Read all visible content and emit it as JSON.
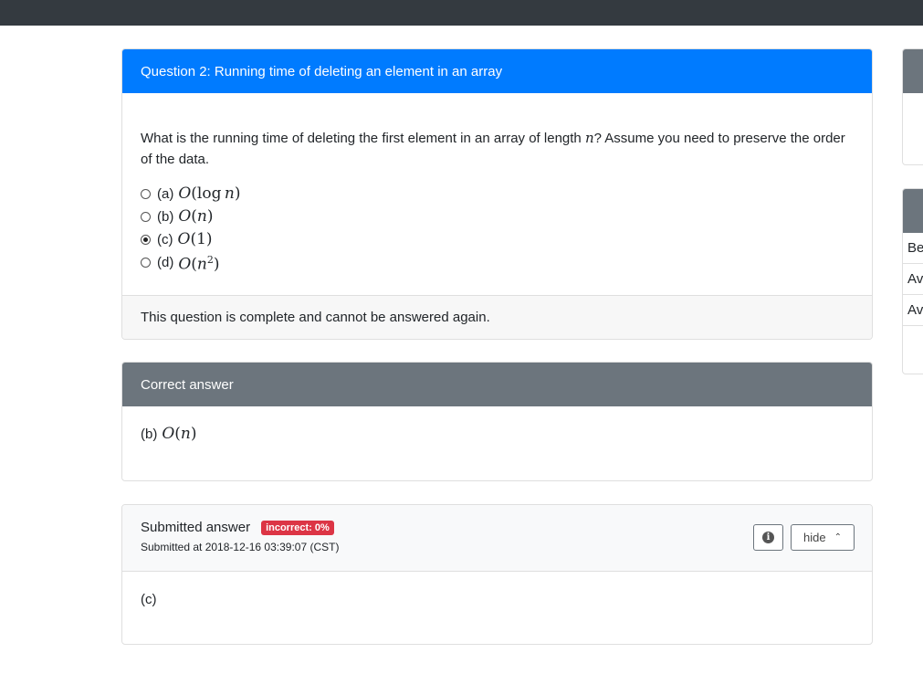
{
  "question": {
    "title": "Question 2: Running time of deleting an element in an array",
    "text_before": "What is the running time of deleting the first element in an array of length",
    "text_var": "n",
    "text_after": "? Assume you need to preserve the order of the data.",
    "options": [
      {
        "label": "(a)",
        "math": "O(log n)",
        "selected": false
      },
      {
        "label": "(b)",
        "math": "O(n)",
        "selected": false
      },
      {
        "label": "(c)",
        "math": "O(1)",
        "selected": true
      },
      {
        "label": "(d)",
        "math": "O(n²)",
        "selected": false
      }
    ],
    "footer": "This question is complete and cannot be answered again."
  },
  "correct": {
    "header": "Correct answer",
    "label": "(b)",
    "math": "O(n)"
  },
  "submitted": {
    "title": "Submitted answer",
    "badge": "incorrect: 0%",
    "time": "Submitted at 2018-12-16 03:39:07 (CST)",
    "info_icon": "info-icon",
    "hide_label": "hide",
    "answer": "(c)"
  },
  "sidebar": {
    "rows": [
      "Be",
      "Av",
      "Av"
    ]
  },
  "colors": {
    "primary": "#007bff",
    "secondary": "#6c757d",
    "danger": "#dc3545",
    "topbar": "#343a40"
  }
}
